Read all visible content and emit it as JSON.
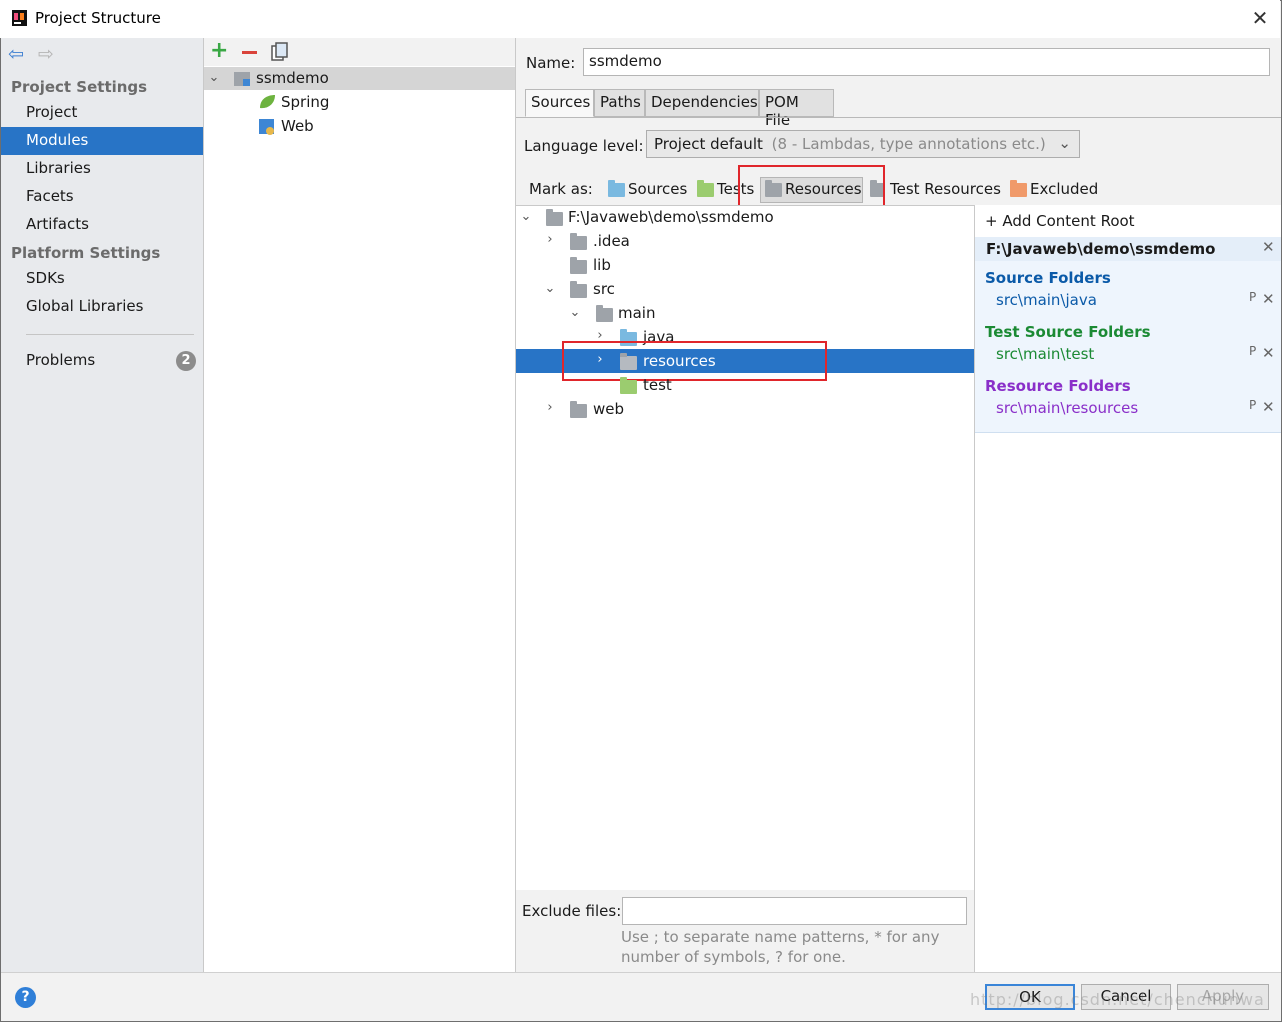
{
  "window": {
    "title": "Project Structure",
    "close_label": "✕"
  },
  "left": {
    "section_project": "Project Settings",
    "project_items": [
      "Project",
      "Modules",
      "Libraries",
      "Facets",
      "Artifacts"
    ],
    "selected": "Modules",
    "section_platform": "Platform Settings",
    "platform_items": [
      "SDKs",
      "Global Libraries"
    ],
    "problems_label": "Problems",
    "problems_count": "2"
  },
  "modules_tree": {
    "root": "ssmdemo",
    "children": [
      "Spring",
      "Web"
    ]
  },
  "form": {
    "name_label": "Name:",
    "name_value": "ssmdemo",
    "tabs": [
      "Sources",
      "Paths",
      "Dependencies",
      "POM File"
    ],
    "active_tab": "Sources",
    "language_label": "Language level:",
    "language_value": "Project default",
    "language_hint": "(8 - Lambdas, type annotations etc.)",
    "mark_as_label": "Mark as:",
    "mark_as": [
      "Sources",
      "Tests",
      "Resources",
      "Test Resources",
      "Excluded"
    ]
  },
  "file_tree": {
    "root": "F:\\Javaweb\\demo\\ssmdemo",
    "nodes": [
      ".idea",
      "lib",
      "src",
      "main",
      "java",
      "resources",
      "test",
      "web"
    ]
  },
  "exclude": {
    "label": "Exclude files:",
    "value": "",
    "hint_line1": "Use ; to separate name patterns, * for any",
    "hint_line2": "number of symbols, ? for one."
  },
  "content_root": {
    "add_label": "+ Add Content Root",
    "path": "F:\\Javaweb\\demo\\ssmdemo",
    "source_title": "Source Folders",
    "source_path": "src\\main\\java",
    "test_title": "Test Source Folders",
    "test_path": "src\\main\\test",
    "resource_title": "Resource Folders",
    "resource_path": "src\\main\\resources",
    "colors": {
      "source": "#0b5aa8",
      "test": "#1b8a34",
      "resource": "#8a2fc9"
    }
  },
  "buttons": {
    "ok": "OK",
    "cancel": "Cancel",
    "apply": "Apply"
  },
  "watermark": "http://blog.csdn.net/chenchunwa"
}
